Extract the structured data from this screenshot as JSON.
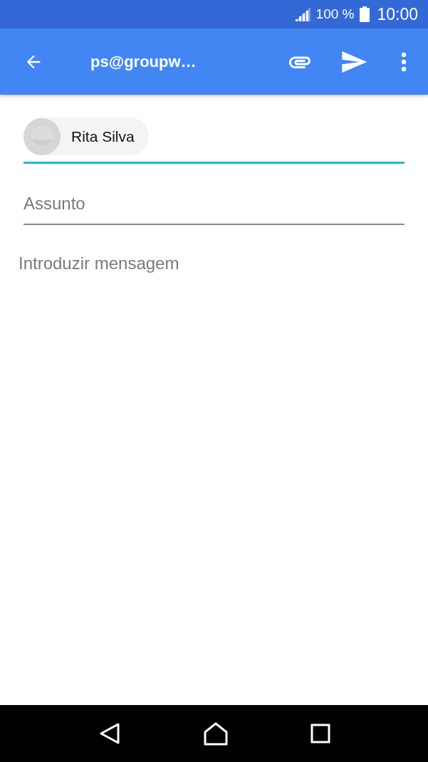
{
  "status_bar": {
    "battery": "100 %",
    "time": "10:00"
  },
  "app_bar": {
    "title": "ps@groupw…"
  },
  "to_field": {
    "focused": true,
    "chips": [
      {
        "name": "Rita Silva"
      }
    ]
  },
  "subject_field": {
    "placeholder": "Assunto",
    "focused": false
  },
  "body_field": {
    "placeholder": "Introduzir mensagem"
  }
}
